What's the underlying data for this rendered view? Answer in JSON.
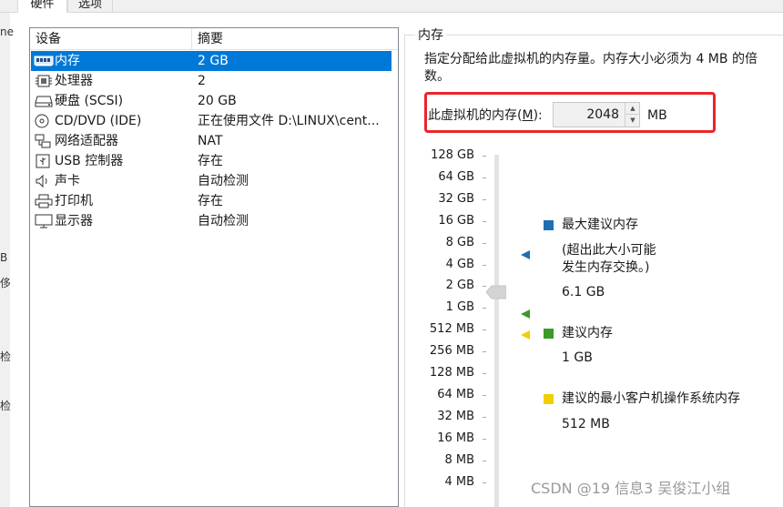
{
  "tabs": [
    {
      "label": "硬件"
    },
    {
      "label": "选项"
    }
  ],
  "edge_fragments": [
    "ne",
    "B",
    "侈",
    "检",
    "检"
  ],
  "device_list": {
    "headers": {
      "device": "设备",
      "summary": "摘要"
    },
    "rows": [
      {
        "icon": "memory-icon",
        "name": "内存",
        "summary": "2 GB",
        "selected": true
      },
      {
        "icon": "processor-icon",
        "name": "处理器",
        "summary": "2"
      },
      {
        "icon": "hard-disk-icon",
        "name": "硬盘 (SCSI)",
        "summary": "20 GB"
      },
      {
        "icon": "cd-dvd-icon",
        "name": "CD/DVD (IDE)",
        "summary": "正在使用文件 D:\\LINUX\\cent..."
      },
      {
        "icon": "network-adapter-icon",
        "name": "网络适配器",
        "summary": "NAT"
      },
      {
        "icon": "usb-icon",
        "name": "USB 控制器",
        "summary": "存在"
      },
      {
        "icon": "sound-card-icon",
        "name": "声卡",
        "summary": "自动检测"
      },
      {
        "icon": "printer-icon",
        "name": "打印机",
        "summary": "存在"
      },
      {
        "icon": "display-icon",
        "name": "显示器",
        "summary": "自动检测"
      }
    ]
  },
  "memory": {
    "group_title": "内存",
    "description": "指定分配给此虚拟机的内存量。内存大小必须为 4 MB 的倍数。",
    "field_label_pre": "此虚拟机的内存(",
    "field_label_key": "M",
    "field_label_post": "):",
    "value": "2048",
    "unit": "MB",
    "slider_labels": [
      "128 GB",
      "64 GB",
      "32 GB",
      "16 GB",
      "8 GB",
      "4 GB",
      "2 GB",
      "1 GB",
      "512 MB",
      "256 MB",
      "128 MB",
      "64 MB",
      "32 MB",
      "16 MB",
      "8 MB",
      "4 MB"
    ],
    "slider_value": "2 GB",
    "legend": {
      "max": {
        "label": "最大建议内存",
        "note_line1": "(超出此大小可能",
        "note_line2": "发生内存交换。)",
        "value": "6.1 GB",
        "color": "#1e6eb4"
      },
      "recommended": {
        "label": "建议内存",
        "value": "1 GB",
        "color": "#3c9a28"
      },
      "min": {
        "label": "建议的最小客户机操作系统内存",
        "value": "512 MB",
        "color": "#f0d000"
      }
    }
  },
  "watermark": "CSDN @19 信息3 吴俊江小组"
}
